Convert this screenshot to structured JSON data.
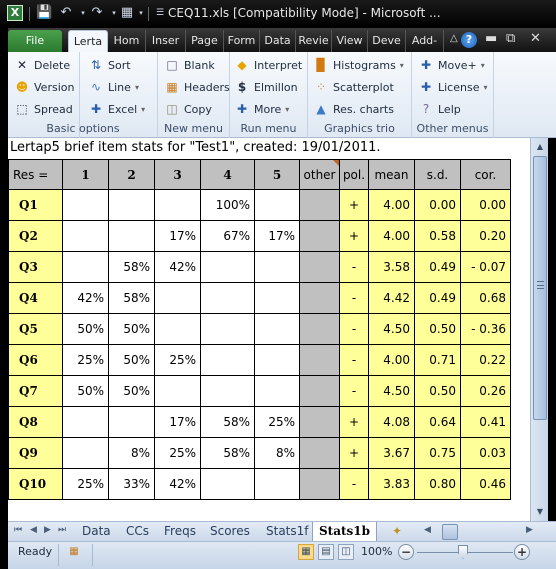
{
  "window": {
    "title": "CEQ11.xls  [Compatibility Mode]  -  Microsoft ...",
    "app_icon": "excel-icon"
  },
  "quick_access": [
    {
      "name": "save-icon"
    },
    {
      "name": "undo-icon"
    },
    {
      "name": "redo-icon"
    },
    {
      "name": "format-icon"
    },
    {
      "name": "customize-icon"
    }
  ],
  "tabs": [
    {
      "label": "File"
    },
    {
      "label": "Lerta",
      "active": true
    },
    {
      "label": "Hom"
    },
    {
      "label": "Inser"
    },
    {
      "label": "Page"
    },
    {
      "label": "Form"
    },
    {
      "label": "Data"
    },
    {
      "label": "Revie"
    },
    {
      "label": "View"
    },
    {
      "label": "Deve"
    },
    {
      "label": "Add-"
    }
  ],
  "ribbon": {
    "groups": [
      {
        "label": "Basic options",
        "buttons": [
          {
            "label": "Delete",
            "icon": "close-x-icon"
          },
          {
            "label": "Version",
            "icon": "smiley-icon"
          },
          {
            "label": "Spread",
            "icon": "spread-icon"
          }
        ]
      },
      {
        "label": "",
        "buttons": [
          {
            "label": "Sort",
            "icon": "sort-icon"
          },
          {
            "label": "Line",
            "icon": "line-chart-icon",
            "dropdown": true
          },
          {
            "label": "Excel",
            "icon": "plus-icon",
            "dropdown": true
          }
        ]
      },
      {
        "label": "New menu",
        "buttons": [
          {
            "label": "Blank",
            "icon": "blank-sheet-icon"
          },
          {
            "label": "Headers",
            "icon": "headers-icon"
          },
          {
            "label": "Copy",
            "icon": "copy-icon"
          }
        ]
      },
      {
        "label": "Run menu",
        "buttons": [
          {
            "label": "Interpret",
            "icon": "warning-diamond-icon"
          },
          {
            "label": "Elmillon",
            "icon": "dollar-icon"
          },
          {
            "label": "More",
            "icon": "plus-icon",
            "dropdown": true
          }
        ]
      },
      {
        "label": "Graphics trio",
        "buttons": [
          {
            "label": "Histograms",
            "icon": "histogram-icon",
            "dropdown": true
          },
          {
            "label": "Scatterplot",
            "icon": "scatterplot-icon"
          },
          {
            "label": "Res. charts",
            "icon": "area-chart-icon"
          }
        ]
      },
      {
        "label": "Other menus",
        "buttons": [
          {
            "label": "Move+",
            "icon": "plus-icon",
            "dropdown": true
          },
          {
            "label": "License",
            "icon": "plus-icon",
            "dropdown": true
          },
          {
            "label": "Lelp",
            "icon": "question-icon"
          }
        ]
      }
    ]
  },
  "sheet": {
    "caption": "Lertap5 brief item stats for \"Test1\", created: 19/01/2011.",
    "headers": [
      "Res =",
      "1",
      "2",
      "3",
      "4",
      "5",
      "other",
      "pol.",
      "mean",
      "s.d.",
      "cor."
    ],
    "rows": [
      {
        "item": "Q1",
        "r1": "",
        "r2": "",
        "r3": "",
        "r4": "100%",
        "r5": "",
        "other": "",
        "pol": "+",
        "mean": "4.00",
        "sd": "0.00",
        "cor": "0.00"
      },
      {
        "item": "Q2",
        "r1": "",
        "r2": "",
        "r3": "17%",
        "r4": "67%",
        "r5": "17%",
        "other": "",
        "pol": "+",
        "mean": "4.00",
        "sd": "0.58",
        "cor": "0.20"
      },
      {
        "item": "Q3",
        "r1": "",
        "r2": "58%",
        "r3": "42%",
        "r4": "",
        "r5": "",
        "other": "",
        "pol": "-",
        "mean": "3.58",
        "sd": "0.49",
        "cor": "- 0.07"
      },
      {
        "item": "Q4",
        "r1": "42%",
        "r2": "58%",
        "r3": "",
        "r4": "",
        "r5": "",
        "other": "",
        "pol": "-",
        "mean": "4.42",
        "sd": "0.49",
        "cor": "0.68"
      },
      {
        "item": "Q5",
        "r1": "50%",
        "r2": "50%",
        "r3": "",
        "r4": "",
        "r5": "",
        "other": "",
        "pol": "-",
        "mean": "4.50",
        "sd": "0.50",
        "cor": "- 0.36"
      },
      {
        "item": "Q6",
        "r1": "25%",
        "r2": "50%",
        "r3": "25%",
        "r4": "",
        "r5": "",
        "other": "",
        "pol": "-",
        "mean": "4.00",
        "sd": "0.71",
        "cor": "0.22"
      },
      {
        "item": "Q7",
        "r1": "50%",
        "r2": "50%",
        "r3": "",
        "r4": "",
        "r5": "",
        "other": "",
        "pol": "-",
        "mean": "4.50",
        "sd": "0.50",
        "cor": "0.26"
      },
      {
        "item": "Q8",
        "r1": "",
        "r2": "",
        "r3": "17%",
        "r4": "58%",
        "r5": "25%",
        "other": "",
        "pol": "+",
        "mean": "4.08",
        "sd": "0.64",
        "cor": "0.41"
      },
      {
        "item": "Q9",
        "r1": "",
        "r2": "8%",
        "r3": "25%",
        "r4": "58%",
        "r5": "8%",
        "other": "",
        "pol": "+",
        "mean": "3.67",
        "sd": "0.75",
        "cor": "0.03"
      },
      {
        "item": "Q10",
        "r1": "25%",
        "r2": "33%",
        "r3": "42%",
        "r4": "",
        "r5": "",
        "other": "",
        "pol": "-",
        "mean": "3.83",
        "sd": "0.80",
        "cor": "0.46"
      }
    ]
  },
  "sheet_tabs": [
    {
      "label": "Data"
    },
    {
      "label": "CCs"
    },
    {
      "label": "Freqs"
    },
    {
      "label": "Scores"
    },
    {
      "label": "Stats1f"
    },
    {
      "label": "Stats1b",
      "active": true
    }
  ],
  "status": {
    "ready": "Ready",
    "zoom": "100%",
    "zoom_minus": "−",
    "zoom_plus": "+"
  },
  "colors": {
    "file_tab": "#2b7a2e",
    "header_gray": "#c0c0c0",
    "stat_yellow": "#ffff99",
    "comment_marker": "#c0652a"
  }
}
